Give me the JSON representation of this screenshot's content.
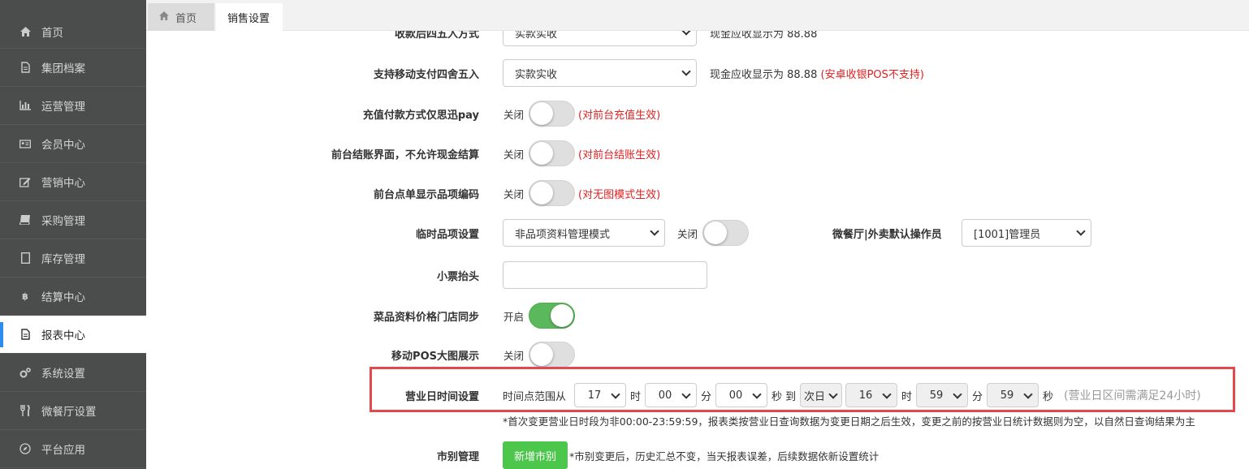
{
  "sidebar": {
    "items": [
      {
        "label": "首页",
        "icon": "home-icon",
        "active": false
      },
      {
        "label": "集团档案",
        "icon": "file-icon",
        "active": false
      },
      {
        "label": "运营管理",
        "icon": "bar-chart-icon",
        "active": false
      },
      {
        "label": "会员中心",
        "icon": "id-card-icon",
        "active": false
      },
      {
        "label": "营销中心",
        "icon": "edit-icon",
        "active": false
      },
      {
        "label": "采购管理",
        "icon": "book-icon",
        "active": false
      },
      {
        "label": "库存管理",
        "icon": "document-icon",
        "active": false
      },
      {
        "label": "结算中心",
        "icon": "bitcoin-icon",
        "active": false
      },
      {
        "label": "报表中心",
        "icon": "report-icon",
        "active": true
      },
      {
        "label": "系统设置",
        "icon": "gears-icon",
        "active": false
      },
      {
        "label": "微餐厅设置",
        "icon": "cutlery-icon",
        "active": false
      },
      {
        "label": "平台应用",
        "icon": "compass-icon",
        "active": false
      }
    ]
  },
  "tabs": {
    "home": "首页",
    "sales": "销售设置"
  },
  "form": {
    "cut_row": {
      "label": "收款后四五入方式",
      "value": "实款实收",
      "hint": "现金应收显示为 88.88"
    },
    "mobile_round": {
      "label": "支持移动支付四舍五入",
      "value": "实款实收",
      "hint": "现金应收显示为 88.88",
      "hint_red": "(安卓收银POS不支持)"
    },
    "recharge_pay": {
      "label": "充值付款方式仅思迅pay",
      "state": "关闭",
      "note": "(对前台充值生效)"
    },
    "no_cash": {
      "label": "前台结账界面，不允许现金结算",
      "state": "关闭",
      "note": "(对前台结账生效)"
    },
    "show_code": {
      "label": "前台点单显示品项编码",
      "state": "关闭",
      "note": "(对无图模式生效)"
    },
    "temp_item": {
      "label": "临时品项设置",
      "value": "非品项资料管理模式",
      "state": "关闭",
      "operator_label": "微餐厅|外卖默认操作员",
      "operator_value": "[1001]管理员"
    },
    "receipt_header": {
      "label": "小票抬头",
      "value": ""
    },
    "price_sync": {
      "label": "菜品资料价格门店同步",
      "state": "开启"
    },
    "pos_big": {
      "label": "移动POS大图展示",
      "state": "关闭"
    },
    "business_day": {
      "label": "营业日时间设置",
      "prefix": "时间点范围从",
      "start_hour": "17",
      "hour_unit": "时",
      "start_min": "00",
      "min_unit": "分",
      "start_sec": "00",
      "sec_unit_to": "秒 到",
      "next_day": "次日",
      "end_hour": "16",
      "end_min": "59",
      "end_sec": "59",
      "sec_unit": "秒",
      "note": "(营业日区间需满足24小时)",
      "warning": "*首次变更营业日时段为非00:00-23:59:59，报表类按营业日查询数据为变更日期之后生效，变更之前的按营业日统计数据则为空，以自然日查询结果为主"
    },
    "city": {
      "label": "市别管理",
      "button": "新增市别",
      "note": "*市别变更后，历史汇总不变，当天报表误差，后续数据依新设置统计"
    }
  },
  "colors": {
    "accent": "#2d8cf0",
    "switch_on": "#5cb85c",
    "button_green": "#4cc74c",
    "highlight": "#e04a4a",
    "note_red": "#e02020",
    "sidebar_bg": "#4a4d4b"
  }
}
